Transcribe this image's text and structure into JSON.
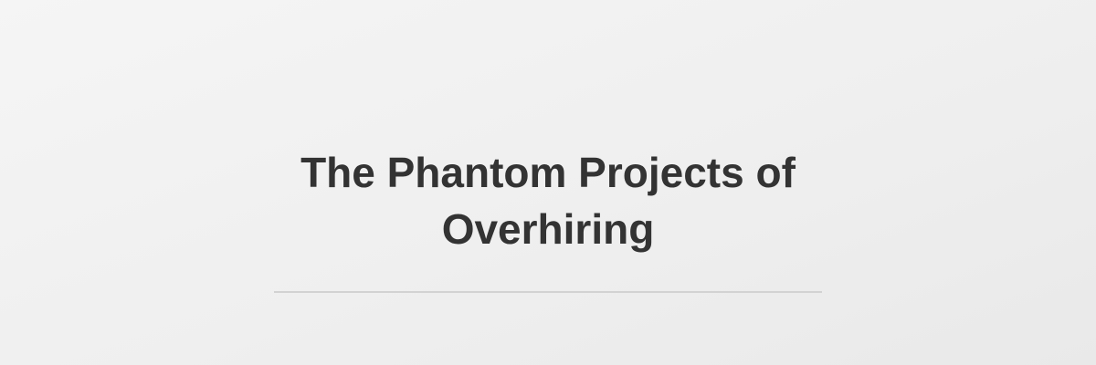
{
  "page": {
    "title": "The Phantom Projects of Overhiring",
    "colors": {
      "background": "#f0f0f0",
      "title_text": "#333333",
      "divider": "#d2d2d2"
    }
  }
}
